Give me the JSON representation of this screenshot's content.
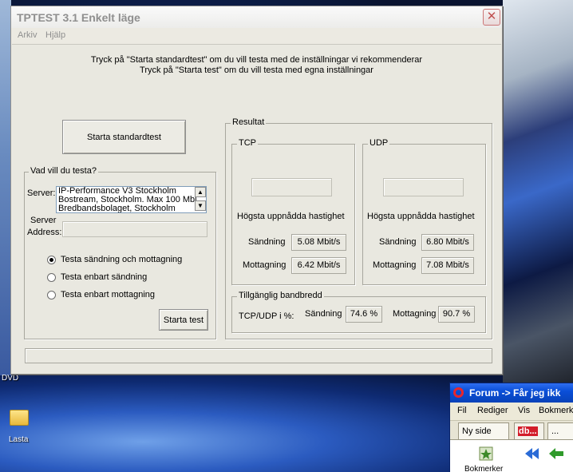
{
  "desktop": {
    "labels": [
      "DVD",
      "Lasta"
    ]
  },
  "window": {
    "title": "TPTEST 3.1 Enkelt läge",
    "close_symbol": "✕",
    "menu": [
      "Arkiv",
      "Hjälp"
    ]
  },
  "intro": {
    "line1": "Tryck på \"Starta standardtest\" om du vill testa med de inställningar vi rekommenderar",
    "line2": "Tryck på \"Starta test\" om du vill testa med egna inställningar"
  },
  "standard_button": "Starta standardtest",
  "test_group": {
    "legend": "Vad vill du testa?",
    "server_label": "Server:",
    "servers": [
      "IP-Performance V3 Stockholm",
      "Bostream, Stockholm. Max 100 Mbi",
      "Bredbandsbolaget, Stockholm"
    ],
    "scroll_up": "▲",
    "scroll_down": "▼",
    "address_label_1": "Server",
    "address_label_2": "Address:",
    "address_value": "",
    "options": [
      {
        "label": "Testa sändning och mottagning",
        "selected": true
      },
      {
        "label": "Testa enbart sändning",
        "selected": false
      },
      {
        "label": "Testa enbart mottagning",
        "selected": false
      }
    ],
    "start_button": "Starta test"
  },
  "result": {
    "legend": "Resultat",
    "tcp": {
      "legend": "TCP",
      "max_speed_value": "",
      "max_speed_label": "Högsta uppnådda hastighet",
      "send_label": "Sändning",
      "send_value": "5.08 Mbit/s",
      "recv_label": "Mottagning",
      "recv_value": "6.42 Mbit/s"
    },
    "udp": {
      "legend": "UDP",
      "max_speed_value": "",
      "max_speed_label": "Högsta uppnådda hastighet",
      "send_label": "Sändning",
      "send_value": "6.80 Mbit/s",
      "recv_label": "Mottagning",
      "recv_value": "7.08 Mbit/s"
    },
    "bandwidth": {
      "legend": "Tillgänglig bandbredd",
      "ratio_label": "TCP/UDP i %:",
      "send_label": "Sändning",
      "send_value": "74.6 %",
      "recv_label": "Mottagning",
      "recv_value": "90.7 %"
    }
  },
  "progress": {
    "value": 0
  },
  "browser": {
    "title": "Forum -> Får jeg ikk",
    "menu": [
      "Fil",
      "Rediger",
      "Vis",
      "Bokmerk"
    ],
    "tabs": [
      "Ny side",
      "db...",
      "..."
    ],
    "bookmark_label": "Bokmerker"
  }
}
